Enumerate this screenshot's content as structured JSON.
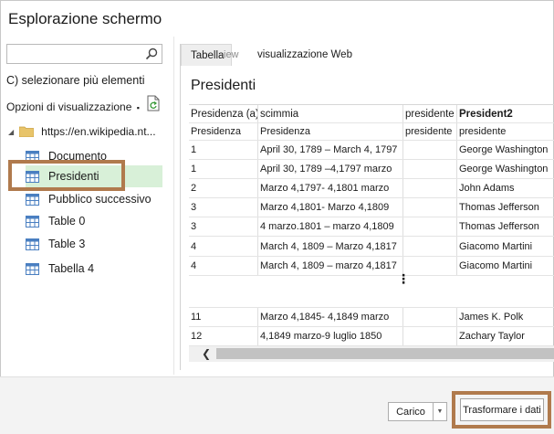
{
  "window": {
    "title": "Esplorazione schermo"
  },
  "sidebar": {
    "search_placeholder": "",
    "multi_select_label": "C) selezionare più elementi",
    "view_options_label": "Opzioni di visualizzazione",
    "view_options_arrow": "▪",
    "root_label": "https://en.wikipedia.nt...",
    "items": [
      {
        "label": "Documento"
      },
      {
        "label": "Presidenti",
        "selected": true
      },
      {
        "label": "Pubblico successivo"
      },
      {
        "label": "Table 0"
      },
      {
        "label": "Table 3"
      },
      {
        "label": "Tabella 4"
      }
    ]
  },
  "preview": {
    "tabs": {
      "table": "Tabella",
      "ghost": "iew",
      "web": "visualizzazione Web"
    },
    "table_title": "Presidenti",
    "headers": [
      "Presidenza (a)",
      "scimmia",
      "presidente",
      "President2"
    ],
    "subheaders": [
      "Presidenza",
      "Presidenza",
      "presidente",
      "presidente"
    ],
    "rows": [
      [
        "1",
        "April 30, 1789 – March 4, 1797",
        "",
        "George Washington"
      ],
      [
        "1",
        "April 30, 1789 –4,1797 marzo",
        "",
        "George Washington"
      ],
      [
        "2",
        "Marzo 4,1797- 4,1801 marzo",
        "",
        "John Adams"
      ],
      [
        "3",
        "Marzo 4,1801- Marzo 4,1809",
        "",
        "Thomas Jefferson"
      ],
      [
        "3",
        "4 marzo.1801 – marzo 4,1809",
        "",
        "Thomas Jefferson"
      ],
      [
        "4",
        "March 4, 1809 – Marzo 4,1817",
        "",
        "Giacomo Martini"
      ],
      [
        "4",
        "March 4, 1809 – marzo 4,1817",
        "",
        "Giacomo Martini"
      ]
    ],
    "ellipsis": "⋮",
    "bottom_rows": [
      [
        "11",
        "Marzo 4,1845- 4,1849 marzo",
        "",
        "James K. Polk"
      ],
      [
        "12",
        "4,1849 marzo-9 luglio 1850",
        "",
        "Zachary Taylor"
      ]
    ],
    "scroll_left": "❮"
  },
  "footer": {
    "load_label": "Carico",
    "load_split_arrow": "▼",
    "transform_label": "Trasformare i dati"
  },
  "colors": {
    "selection": "#d8f0d8",
    "highlight": "#b07a4d"
  }
}
